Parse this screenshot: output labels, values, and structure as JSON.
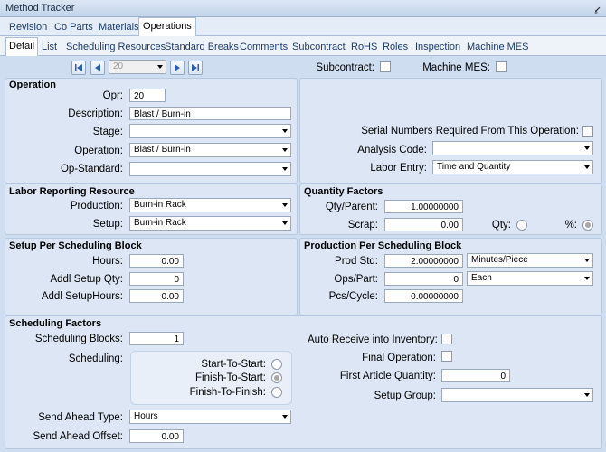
{
  "window": {
    "title": "Method Tracker",
    "pin_icon": "pin-icon"
  },
  "main_tabs": [
    "Revision",
    "Co Parts",
    "Materials",
    "Operations"
  ],
  "sub_tabs": [
    "Detail",
    "List",
    "Scheduling Resources",
    "Standard Breaks",
    "Comments",
    "Subcontract",
    "RoHS",
    "Roles",
    "Inspection",
    "Machine MES"
  ],
  "nav": {
    "current": "20",
    "subcontract_label": "Subcontract:",
    "machine_mes_label": "Machine MES:"
  },
  "operation": {
    "header": "Operation",
    "opr_label": "Opr:",
    "opr_value": "20",
    "description_label": "Description:",
    "description_value": "Blast / Burn-in",
    "stage_label": "Stage:",
    "stage_value": "",
    "operation_label": "Operation:",
    "operation_value": "Blast / Burn-in",
    "opstandard_label": "Op-Standard:",
    "opstandard_value": "",
    "serial_label": "Serial Numbers Required From This Operation:",
    "analysis_label": "Analysis Code:",
    "analysis_value": "",
    "labor_entry_label": "Labor Entry:",
    "labor_entry_value": "Time and Quantity"
  },
  "labor": {
    "header": "Labor Reporting Resource",
    "production_label": "Production:",
    "production_value": "Burn-in Rack",
    "setup_label": "Setup:",
    "setup_value": "Burn-in Rack"
  },
  "quantity": {
    "header": "Quantity Factors",
    "qtyparent_label": "Qty/Parent:",
    "qtyparent_value": "1.00000000",
    "scrap_label": "Scrap:",
    "scrap_value": "0.00",
    "qty_label": "Qty:",
    "pct_label": "%:"
  },
  "setup_block": {
    "header": "Setup Per Scheduling Block",
    "hours_label": "Hours:",
    "hours_value": "0.00",
    "addl_qty_label": "Addl Setup Qty:",
    "addl_qty_value": "0",
    "addl_hours_label": "Addl SetupHours:",
    "addl_hours_value": "0.00"
  },
  "production_block": {
    "header": "Production Per Scheduling Block",
    "prodstd_label": "Prod Std:",
    "prodstd_value": "2.00000000",
    "prodstd_unit": "Minutes/Piece",
    "opspart_label": "Ops/Part:",
    "opspart_value": "0",
    "opspart_unit": "Each",
    "pcscycle_label": "Pcs/Cycle:",
    "pcscycle_value": "0.00000000"
  },
  "scheduling": {
    "header": "Scheduling Factors",
    "blocks_label": "Scheduling Blocks:",
    "blocks_value": "1",
    "scheduling_label": "Scheduling:",
    "sts_label": "Start-To-Start:",
    "fts_label": "Finish-To-Start:",
    "ftf_label": "Finish-To-Finish:",
    "send_type_label": "Send Ahead Type:",
    "send_type_value": "Hours",
    "send_offset_label": "Send Ahead Offset:",
    "send_offset_value": "0.00",
    "auto_receive_label": "Auto Receive into Inventory:",
    "final_op_label": "Final Operation:",
    "first_article_label": "First Article Quantity:",
    "first_article_value": "0",
    "setup_group_label": "Setup Group:",
    "setup_group_value": ""
  }
}
